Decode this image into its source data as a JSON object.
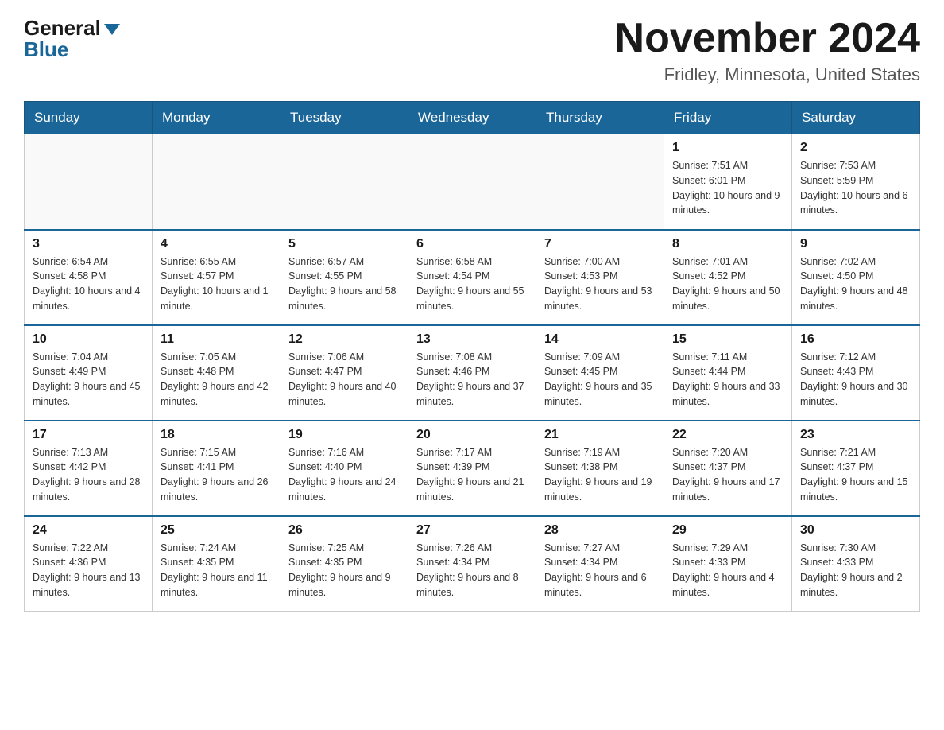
{
  "header": {
    "logo_general": "General",
    "logo_blue": "Blue",
    "month_title": "November 2024",
    "location": "Fridley, Minnesota, United States"
  },
  "days_of_week": [
    "Sunday",
    "Monday",
    "Tuesday",
    "Wednesday",
    "Thursday",
    "Friday",
    "Saturday"
  ],
  "weeks": [
    [
      {
        "day": "",
        "info": ""
      },
      {
        "day": "",
        "info": ""
      },
      {
        "day": "",
        "info": ""
      },
      {
        "day": "",
        "info": ""
      },
      {
        "day": "",
        "info": ""
      },
      {
        "day": "1",
        "info": "Sunrise: 7:51 AM\nSunset: 6:01 PM\nDaylight: 10 hours and 9 minutes."
      },
      {
        "day": "2",
        "info": "Sunrise: 7:53 AM\nSunset: 5:59 PM\nDaylight: 10 hours and 6 minutes."
      }
    ],
    [
      {
        "day": "3",
        "info": "Sunrise: 6:54 AM\nSunset: 4:58 PM\nDaylight: 10 hours and 4 minutes."
      },
      {
        "day": "4",
        "info": "Sunrise: 6:55 AM\nSunset: 4:57 PM\nDaylight: 10 hours and 1 minute."
      },
      {
        "day": "5",
        "info": "Sunrise: 6:57 AM\nSunset: 4:55 PM\nDaylight: 9 hours and 58 minutes."
      },
      {
        "day": "6",
        "info": "Sunrise: 6:58 AM\nSunset: 4:54 PM\nDaylight: 9 hours and 55 minutes."
      },
      {
        "day": "7",
        "info": "Sunrise: 7:00 AM\nSunset: 4:53 PM\nDaylight: 9 hours and 53 minutes."
      },
      {
        "day": "8",
        "info": "Sunrise: 7:01 AM\nSunset: 4:52 PM\nDaylight: 9 hours and 50 minutes."
      },
      {
        "day": "9",
        "info": "Sunrise: 7:02 AM\nSunset: 4:50 PM\nDaylight: 9 hours and 48 minutes."
      }
    ],
    [
      {
        "day": "10",
        "info": "Sunrise: 7:04 AM\nSunset: 4:49 PM\nDaylight: 9 hours and 45 minutes."
      },
      {
        "day": "11",
        "info": "Sunrise: 7:05 AM\nSunset: 4:48 PM\nDaylight: 9 hours and 42 minutes."
      },
      {
        "day": "12",
        "info": "Sunrise: 7:06 AM\nSunset: 4:47 PM\nDaylight: 9 hours and 40 minutes."
      },
      {
        "day": "13",
        "info": "Sunrise: 7:08 AM\nSunset: 4:46 PM\nDaylight: 9 hours and 37 minutes."
      },
      {
        "day": "14",
        "info": "Sunrise: 7:09 AM\nSunset: 4:45 PM\nDaylight: 9 hours and 35 minutes."
      },
      {
        "day": "15",
        "info": "Sunrise: 7:11 AM\nSunset: 4:44 PM\nDaylight: 9 hours and 33 minutes."
      },
      {
        "day": "16",
        "info": "Sunrise: 7:12 AM\nSunset: 4:43 PM\nDaylight: 9 hours and 30 minutes."
      }
    ],
    [
      {
        "day": "17",
        "info": "Sunrise: 7:13 AM\nSunset: 4:42 PM\nDaylight: 9 hours and 28 minutes."
      },
      {
        "day": "18",
        "info": "Sunrise: 7:15 AM\nSunset: 4:41 PM\nDaylight: 9 hours and 26 minutes."
      },
      {
        "day": "19",
        "info": "Sunrise: 7:16 AM\nSunset: 4:40 PM\nDaylight: 9 hours and 24 minutes."
      },
      {
        "day": "20",
        "info": "Sunrise: 7:17 AM\nSunset: 4:39 PM\nDaylight: 9 hours and 21 minutes."
      },
      {
        "day": "21",
        "info": "Sunrise: 7:19 AM\nSunset: 4:38 PM\nDaylight: 9 hours and 19 minutes."
      },
      {
        "day": "22",
        "info": "Sunrise: 7:20 AM\nSunset: 4:37 PM\nDaylight: 9 hours and 17 minutes."
      },
      {
        "day": "23",
        "info": "Sunrise: 7:21 AM\nSunset: 4:37 PM\nDaylight: 9 hours and 15 minutes."
      }
    ],
    [
      {
        "day": "24",
        "info": "Sunrise: 7:22 AM\nSunset: 4:36 PM\nDaylight: 9 hours and 13 minutes."
      },
      {
        "day": "25",
        "info": "Sunrise: 7:24 AM\nSunset: 4:35 PM\nDaylight: 9 hours and 11 minutes."
      },
      {
        "day": "26",
        "info": "Sunrise: 7:25 AM\nSunset: 4:35 PM\nDaylight: 9 hours and 9 minutes."
      },
      {
        "day": "27",
        "info": "Sunrise: 7:26 AM\nSunset: 4:34 PM\nDaylight: 9 hours and 8 minutes."
      },
      {
        "day": "28",
        "info": "Sunrise: 7:27 AM\nSunset: 4:34 PM\nDaylight: 9 hours and 6 minutes."
      },
      {
        "day": "29",
        "info": "Sunrise: 7:29 AM\nSunset: 4:33 PM\nDaylight: 9 hours and 4 minutes."
      },
      {
        "day": "30",
        "info": "Sunrise: 7:30 AM\nSunset: 4:33 PM\nDaylight: 9 hours and 2 minutes."
      }
    ]
  ]
}
